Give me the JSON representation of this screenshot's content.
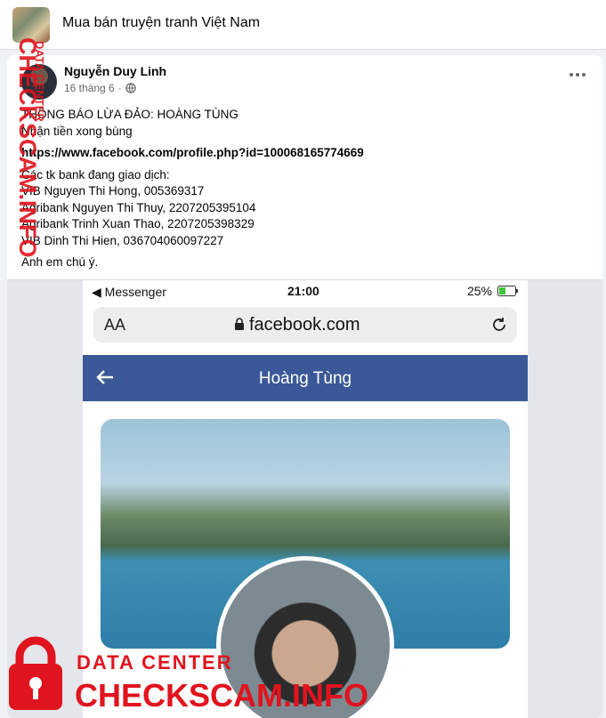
{
  "group": {
    "name": "Mua bán truyện tranh Việt Nam"
  },
  "post": {
    "author": "Nguyễn Duy Linh",
    "date": "16 tháng 6",
    "date_separator": "·",
    "lines": [
      "THÔNG BÁO LỪA ĐẢO: HOÀNG TÙNG",
      "Nhận tiền xong bùng"
    ],
    "link": "https://www.facebook.com/profile.php?id=100068165774669",
    "bank_intro": "Các tk bank đang giao dịch:",
    "banks": [
      "VIB Nguyen Thi Hong, 005369317",
      "Agribank Nguyen Thi Thuy, 2207205395104",
      "Agribank Trinh Xuan Thao, 2207205398329",
      "VIB Dinh Thi Hien, 036704060097227"
    ],
    "closing": "Anh em chú ý."
  },
  "screenshot": {
    "status_left": "◀ Messenger",
    "status_time": "21:00",
    "status_battery": "25%",
    "url_aa": "AA",
    "url_host": "facebook.com",
    "profile_title": "Hoàng Tùng"
  },
  "watermark": {
    "side_text": "CHECKSCAM.INFO",
    "side_small": "DATA CENTER",
    "bottom_small": "DATA CENTER",
    "bottom_big": "CHECKSCAM.INFO",
    "color": "#e0141e"
  }
}
